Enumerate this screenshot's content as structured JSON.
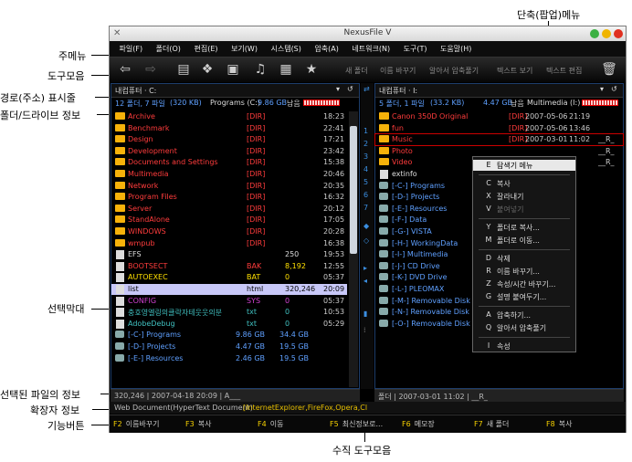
{
  "callouts": {
    "main_menu": "주메뉴",
    "toolbar": "도구모음",
    "path_bar": "경로(주소) 표시줄",
    "folder_drive_info": "폴더/드라이브 정보",
    "selection_bar": "선택막대",
    "selected_file_info": "선택된 파일의 정보",
    "extension_info": "확장자 정보",
    "function_buttons": "기능버튼",
    "context_menu": "단축(팝업)메뉴",
    "vertical_toolbar": "수직 도구모음"
  },
  "window": {
    "title": "NexusFile V"
  },
  "menu": [
    "파일(F)",
    "폴더(O)",
    "편집(E)",
    "보기(W)",
    "시스템(S)",
    "압축(A)",
    "네트워크(N)",
    "도구(T)",
    "도움말(H)"
  ],
  "toolbar": {
    "icons": [
      "back-icon",
      "forward-icon",
      "view-icon",
      "image-icon",
      "cards-icon",
      "music-icon",
      "film-icon",
      "star-icon",
      "trash-icon"
    ],
    "actions": [
      "새 폴더",
      "이름 바꾸기",
      "알아서 압축풀기",
      "텍스트 보기",
      "텍스트 편집"
    ]
  },
  "left": {
    "path": "내컴퓨터 · C:",
    "info_count": "12 폴더, 7 파일",
    "info_size": "(320 KB)",
    "info_drive": "Programs (C:)",
    "info_free": "9.86 GB",
    "info_free_suffix": "남음",
    "rows": [
      {
        "name": "Archive",
        "type": "[DIR]",
        "size": "",
        "time": "18:23",
        "kind": "dir"
      },
      {
        "name": "Benchmark",
        "type": "[DIR]",
        "size": "",
        "time": "22:41",
        "kind": "dir"
      },
      {
        "name": "Design",
        "type": "[DIR]",
        "size": "",
        "time": "17:21",
        "kind": "dir"
      },
      {
        "name": "Development",
        "type": "[DIR]",
        "size": "",
        "time": "23:42",
        "kind": "dir"
      },
      {
        "name": "Documents and Settings",
        "type": "[DIR]",
        "size": "",
        "time": "15:38",
        "kind": "dir"
      },
      {
        "name": "Multimedia",
        "type": "[DIR]",
        "size": "",
        "time": "20:46",
        "kind": "dir"
      },
      {
        "name": "Network",
        "type": "[DIR]",
        "size": "",
        "time": "20:35",
        "kind": "dir"
      },
      {
        "name": "Program Files",
        "type": "[DIR]",
        "size": "",
        "time": "16:32",
        "kind": "dir"
      },
      {
        "name": "Server",
        "type": "[DIR]",
        "size": "",
        "time": "20:12",
        "kind": "dir"
      },
      {
        "name": "StandAlone",
        "type": "[DIR]",
        "size": "",
        "time": "17:05",
        "kind": "dir"
      },
      {
        "name": "WINDOWS",
        "type": "[DIR]",
        "size": "",
        "time": "20:28",
        "kind": "dir"
      },
      {
        "name": "wmpub",
        "type": "[DIR]",
        "size": "",
        "time": "16:38",
        "kind": "dir"
      },
      {
        "name": "EFS",
        "type": "",
        "size": "250",
        "time": "19:53",
        "kind": "file"
      },
      {
        "name": "BOOTSECT",
        "type": "BAK",
        "size": "8,192",
        "time": "12:55",
        "kind": "bak"
      },
      {
        "name": "AUTOEXEC",
        "type": "BAT",
        "size": "0",
        "time": "05:37",
        "kind": "bat"
      },
      {
        "name": "list",
        "type": "html",
        "size": "320,246",
        "time": "20:09",
        "kind": "sel"
      },
      {
        "name": "CONFIG",
        "type": "SYS",
        "size": "0",
        "time": "05:37",
        "kind": "sys"
      },
      {
        "name": "충호영엘링의클락자테웃웃의분",
        "type": "txt",
        "size": "0",
        "time": "10:53",
        "kind": "txt"
      },
      {
        "name": "AdobeDebug",
        "type": "txt",
        "size": "0",
        "time": "05:29",
        "kind": "txt"
      },
      {
        "name": "[-C-] Programs",
        "type": "9.86 GB",
        "size": "34.4 GB",
        "time": "",
        "kind": "drv"
      },
      {
        "name": "[-D-] Projects",
        "type": "4.47 GB",
        "size": "19.5 GB",
        "time": "",
        "kind": "drv"
      },
      {
        "name": "[-E-] Resources",
        "type": "2.46 GB",
        "size": "19.5 GB",
        "time": "",
        "kind": "drv"
      }
    ],
    "status": "320,246 | 2007-04-18 20:09 | A___"
  },
  "right": {
    "path": "내컴퓨터 · I:",
    "info_count": "5 폴더, 1 파일",
    "info_size": "(33.2 KB)",
    "info_free": "4.47 GB",
    "info_free_suffix": "남음",
    "info_drive": "Multimedia (I:)",
    "rows": [
      {
        "name": "Canon 350D Original",
        "type": "[DIR]",
        "date": "2007-05-06",
        "time": "21:19",
        "attr": "",
        "kind": "dir"
      },
      {
        "name": "fun",
        "type": "[DIR]",
        "date": "2007-05-06",
        "time": "13:46",
        "attr": "",
        "kind": "dir"
      },
      {
        "name": "Music",
        "type": "[DIR]",
        "date": "2007-03-01",
        "time": "11:02",
        "attr": "__R_",
        "kind": "dirsel"
      },
      {
        "name": "Photo",
        "type": "",
        "date": "",
        "time": "",
        "attr": "__R_",
        "kind": "dir"
      },
      {
        "name": "Video",
        "type": "",
        "date": "",
        "time": "",
        "attr": "__R_",
        "kind": "dir"
      },
      {
        "name": "extinfo",
        "type": "",
        "date": "",
        "time": "",
        "attr": "",
        "kind": "file"
      },
      {
        "name": "[-C-] Programs",
        "type": "",
        "date": "",
        "time": "",
        "attr": "",
        "kind": "drv"
      },
      {
        "name": "[-D-] Projects",
        "type": "",
        "date": "",
        "time": "",
        "attr": "",
        "kind": "drv"
      },
      {
        "name": "[-E-] Resources",
        "type": "",
        "date": "",
        "time": "",
        "attr": "",
        "kind": "drv"
      },
      {
        "name": "[-F-] Data",
        "type": "",
        "date": "",
        "time": "",
        "attr": "",
        "kind": "drv"
      },
      {
        "name": "[-G-] VISTA",
        "type": "",
        "date": "",
        "time": "",
        "attr": "",
        "kind": "drv"
      },
      {
        "name": "[-H-] WorkingData",
        "type": "",
        "date": "",
        "time": "",
        "attr": "",
        "kind": "drv"
      },
      {
        "name": "[-I-] Multimedia",
        "type": "",
        "date": "",
        "time": "",
        "attr": "",
        "kind": "drv"
      },
      {
        "name": "[-J-] CD Drive",
        "type": "",
        "date": "",
        "time": "",
        "attr": "",
        "kind": "drv"
      },
      {
        "name": "[-K-] DVD Drive",
        "type": "",
        "date": "",
        "time": "",
        "attr": "",
        "kind": "drv"
      },
      {
        "name": "[-L-] PLEOMAX",
        "type": "",
        "date": "",
        "time": "",
        "attr": "",
        "kind": "drv"
      },
      {
        "name": "[-M-] Removable Disk",
        "type": "",
        "date": "",
        "time": "",
        "attr": "",
        "kind": "drv"
      },
      {
        "name": "[-N-] Removable Disk",
        "type": "",
        "date": "",
        "time": "",
        "attr": "",
        "kind": "drv"
      },
      {
        "name": "[-O-] Removable Disk",
        "type": "",
        "date": "",
        "time": "",
        "attr": "",
        "kind": "drv"
      }
    ],
    "status": "폴더 | 2007-03-01 11:02 | __R_"
  },
  "vertical_toolbar": [
    "1",
    "2",
    "3",
    "4",
    "5",
    "6",
    "7"
  ],
  "context_menu": [
    {
      "key": "E",
      "label": "탐색기 메뉴"
    },
    {
      "key": "C",
      "label": "복사"
    },
    {
      "key": "X",
      "label": "잘라내기"
    },
    {
      "key": "V",
      "label": "붙여넣기"
    },
    {
      "key": "Y",
      "label": "폴더로 복사..."
    },
    {
      "key": "M",
      "label": "폴더로 이동..."
    },
    {
      "key": "D",
      "label": "삭제"
    },
    {
      "key": "R",
      "label": "이름 바꾸기..."
    },
    {
      "key": "Z",
      "label": "속성/시간 바꾸기..."
    },
    {
      "key": "G",
      "label": "설명 붙여두기..."
    },
    {
      "key": "A",
      "label": "압축하기..."
    },
    {
      "key": "Q",
      "label": "알아서 압축풀기"
    },
    {
      "key": "I",
      "label": "속성"
    }
  ],
  "ext_info": {
    "label": "Web Document(HyperText Document)",
    "apps": "[InternetExplorer,FireFox,Opera,Cl"
  },
  "function_keys": [
    {
      "key": "F2",
      "label": "이름바꾸기"
    },
    {
      "key": "F3",
      "label": "복사"
    },
    {
      "key": "F4",
      "label": "이동"
    },
    {
      "key": "F5",
      "label": "최신정보로..."
    },
    {
      "key": "F6",
      "label": "메모장"
    },
    {
      "key": "F7",
      "label": "새 폴더"
    },
    {
      "key": "F8",
      "label": "복사"
    }
  ]
}
